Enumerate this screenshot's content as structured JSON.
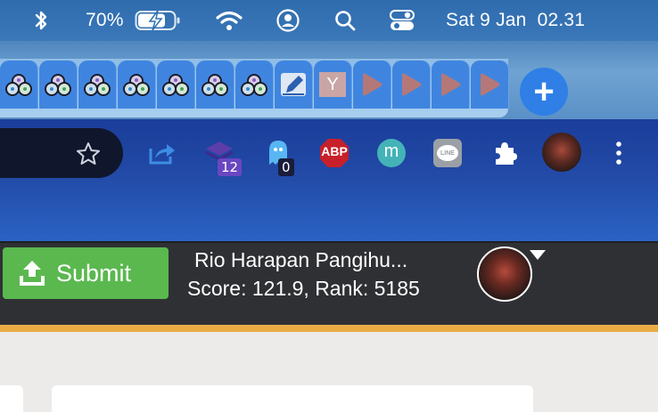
{
  "menubar": {
    "battery_percent": "70%",
    "datetime": "Sat 9 Jan  02.31",
    "icons": [
      "bluetooth-icon",
      "battery-charging-icon",
      "wifi-icon",
      "user-icon",
      "spotlight-search-icon",
      "control-center-icon"
    ]
  },
  "tabs": {
    "favicons": [
      "shared-drive-icon",
      "shared-drive-icon",
      "shared-drive-icon",
      "shared-drive-icon",
      "shared-drive-icon",
      "shared-drive-icon",
      "shared-drive-icon",
      "pen-icon",
      "y-icon",
      "play-icon",
      "play-icon",
      "play-icon",
      "play-icon"
    ],
    "y_label": "Y",
    "new_tab_label": "+"
  },
  "toolbar": {
    "bookmark_icon": "star-icon",
    "extensions": [
      {
        "name": "share-icon"
      },
      {
        "name": "stack-icon",
        "badge": "12"
      },
      {
        "name": "ghost-icon",
        "badge": "0"
      },
      {
        "name": "adblock-icon",
        "label": "ABP"
      },
      {
        "name": "m-icon",
        "label": "m"
      },
      {
        "name": "line-icon",
        "label": "LINE"
      },
      {
        "name": "puzzle-icon"
      },
      {
        "name": "profile-avatar"
      },
      {
        "name": "more-menu-icon"
      }
    ]
  },
  "header": {
    "submit_label": "Submit",
    "username": "Rio Harapan Pangihu...",
    "score_line": "Score: 121.9, Rank: 5185"
  },
  "colors": {
    "menubar": "#3070b2",
    "toolbar": "#224aa6",
    "header": "#2f3034",
    "submit": "#5ab84f",
    "accent_line": "#e9ac45"
  }
}
